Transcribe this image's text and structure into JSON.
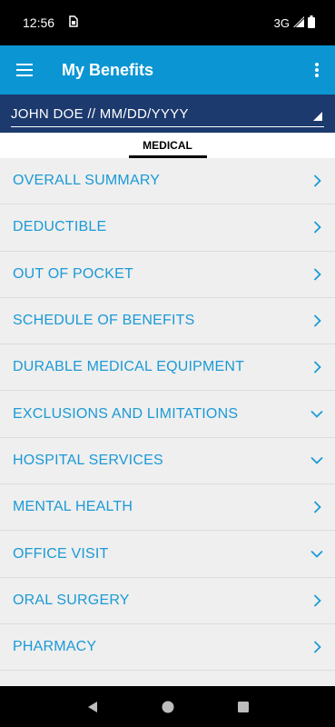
{
  "status_bar": {
    "time": "12:56",
    "sim_icon": "sim-card-icon",
    "network": "3G",
    "signal_icon": "signal-icon",
    "battery_icon": "battery-icon"
  },
  "app_bar": {
    "title": "My Benefits",
    "menu_icon": "hamburger-menu-icon",
    "overflow_icon": "more-vertical-icon",
    "background": "#0b96d3"
  },
  "member": {
    "selected": "JOHN DOE // MM/DD/YYYY",
    "background": "#1c3a6e"
  },
  "tabs": [
    {
      "label": "MEDICAL",
      "active": true
    }
  ],
  "list": {
    "accent": "#1b9ad6",
    "items": [
      {
        "label": "OVERALL SUMMARY",
        "icon": "chevron-right-icon"
      },
      {
        "label": "DEDUCTIBLE",
        "icon": "chevron-right-icon"
      },
      {
        "label": "OUT OF POCKET",
        "icon": "chevron-right-icon"
      },
      {
        "label": "SCHEDULE OF BENEFITS",
        "icon": "chevron-right-icon"
      },
      {
        "label": "DURABLE MEDICAL EQUIPMENT",
        "icon": "chevron-right-icon"
      },
      {
        "label": "EXCLUSIONS AND LIMITATIONS",
        "icon": "chevron-down-icon"
      },
      {
        "label": "HOSPITAL SERVICES",
        "icon": "chevron-down-icon"
      },
      {
        "label": "MENTAL HEALTH",
        "icon": "chevron-right-icon"
      },
      {
        "label": "OFFICE VISIT",
        "icon": "chevron-down-icon"
      },
      {
        "label": "ORAL SURGERY",
        "icon": "chevron-right-icon"
      },
      {
        "label": "PHARMACY",
        "icon": "chevron-right-icon"
      }
    ]
  },
  "nav_bar": {
    "back_icon": "back-triangle-icon",
    "home_icon": "home-circle-icon",
    "recents_icon": "recents-square-icon"
  }
}
